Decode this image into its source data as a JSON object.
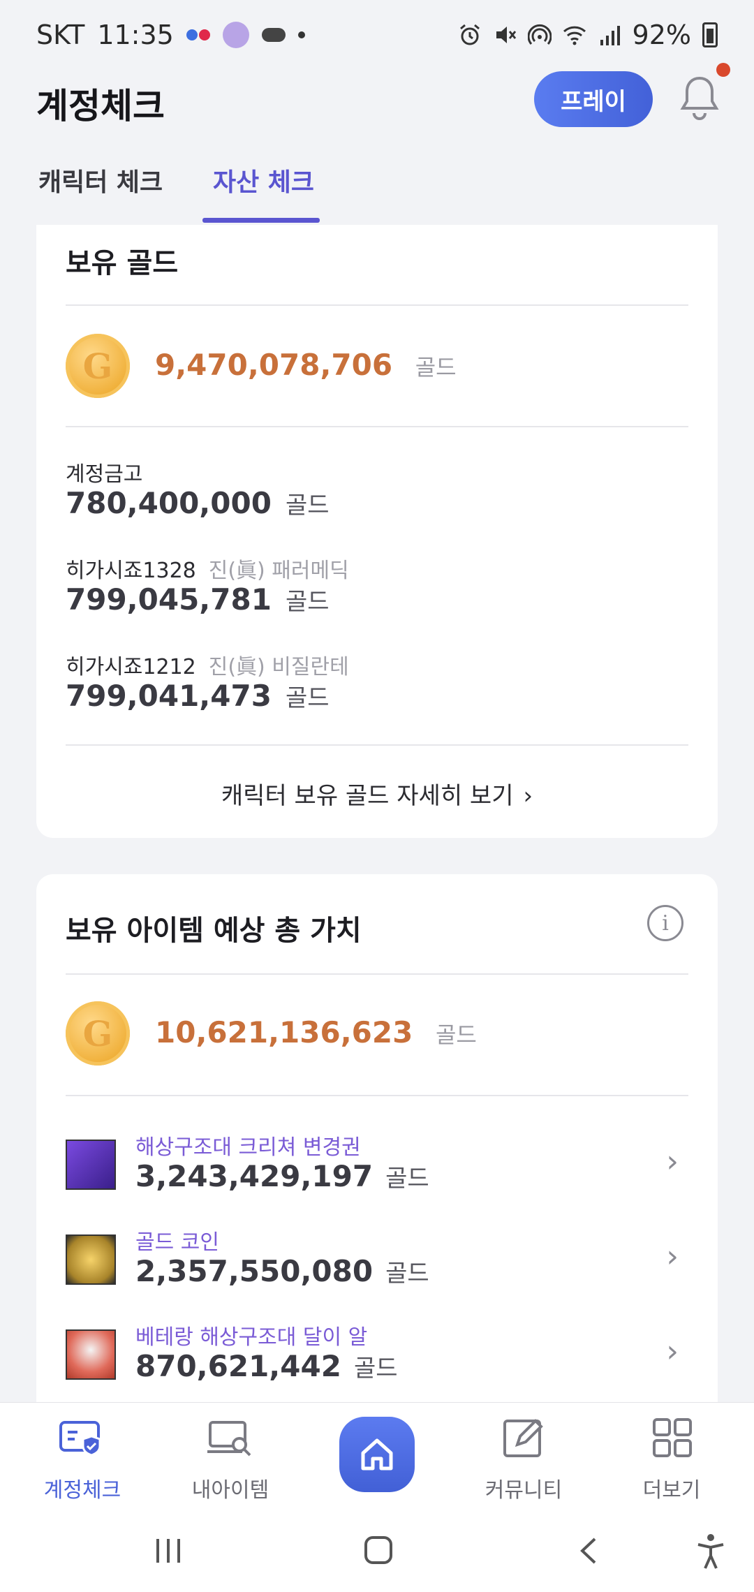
{
  "status_bar": {
    "carrier": "SKT",
    "time": "11:35",
    "battery": "92%"
  },
  "header": {
    "title": "계정체크",
    "pray_button": "프레이"
  },
  "tabs": [
    {
      "label": "캐릭터 체크",
      "active": false
    },
    {
      "label": "자산 체크",
      "active": true
    }
  ],
  "gold_card": {
    "title": "보유 골드",
    "coin_letter": "G",
    "total": "9,470,078,706",
    "unit": "골드",
    "rows": [
      {
        "label": "계정금고",
        "sub": "",
        "amount": "780,400,000",
        "unit": "골드"
      },
      {
        "label": "히가시죠1328",
        "sub": "진(眞) 패러메딕",
        "amount": "799,045,781",
        "unit": "골드"
      },
      {
        "label": "히가시죠1212",
        "sub": "진(眞) 비질란테",
        "amount": "799,041,473",
        "unit": "골드"
      }
    ],
    "detail_link": "캐릭터 보유 골드 자세히 보기"
  },
  "items_card": {
    "title": "보유 아이템 예상 총 가치",
    "info_icon": "i",
    "coin_letter": "G",
    "total": "10,621,136,623",
    "unit": "골드",
    "items": [
      {
        "name": "해상구조대 크리쳐 변경권",
        "amount": "3,243,429,197",
        "unit": "골드",
        "icon": "ticket-icon",
        "color": "#4a2c9a"
      },
      {
        "name": "골드 코인",
        "amount": "2,357,550,080",
        "unit": "골드",
        "icon": "gold-coin-item-icon",
        "color": "#b08a2a"
      },
      {
        "name": "베테랑 해상구조대 달이 알",
        "amount": "870,621,442",
        "unit": "골드",
        "icon": "egg-icon",
        "color": "#c0483a"
      }
    ]
  },
  "bottom_nav": [
    {
      "label": "계정체크",
      "icon": "account-check-icon",
      "active": true
    },
    {
      "label": "내아이템",
      "icon": "my-items-icon",
      "active": false
    },
    {
      "label": "",
      "icon": "home-icon",
      "active": false
    },
    {
      "label": "커뮤니티",
      "icon": "community-icon",
      "active": false
    },
    {
      "label": "더보기",
      "icon": "more-grid-icon",
      "active": false
    }
  ],
  "colors": {
    "accent": "#5a55d0",
    "gold_amount": "#c8703a",
    "item_name": "#7a5bd6",
    "nav_active": "#4a62d8"
  }
}
